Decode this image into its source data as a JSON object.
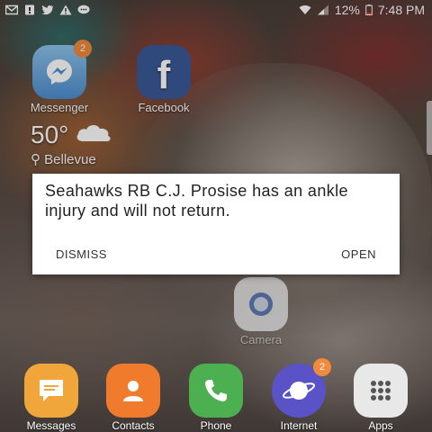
{
  "status_bar": {
    "battery": "12%",
    "time": "7:48 PM",
    "left_icons": [
      "mail-icon",
      "notification-icon",
      "twitter-icon",
      "warning-icon",
      "chat-icon"
    ],
    "right_icons": [
      "wifi-icon",
      "signal-icon",
      "battery-icon"
    ]
  },
  "home": {
    "apps": [
      {
        "label": "Messenger",
        "badge": "2",
        "color": "#5b9bd5"
      },
      {
        "label": "Facebook",
        "badge": "",
        "color": "#3b5998"
      }
    ],
    "weather": {
      "temp": "50°",
      "location": "Bellevue",
      "icon": "cloud-icon"
    },
    "camera": {
      "label": "Camera"
    }
  },
  "dialog": {
    "message": "Seahawks RB C.J. Prosise has an ankle injury and will not return.",
    "dismiss_label": "DISMISS",
    "open_label": "OPEN"
  },
  "dock": [
    {
      "label": "Messages",
      "color": "#f0a63a",
      "badge": ""
    },
    {
      "label": "Contacts",
      "color": "#f07b2c",
      "badge": ""
    },
    {
      "label": "Phone",
      "color": "#4cb050",
      "badge": ""
    },
    {
      "label": "Internet",
      "color": "#5a53c8",
      "badge": "2"
    },
    {
      "label": "Apps",
      "color": "#e8e8e8",
      "badge": ""
    }
  ]
}
